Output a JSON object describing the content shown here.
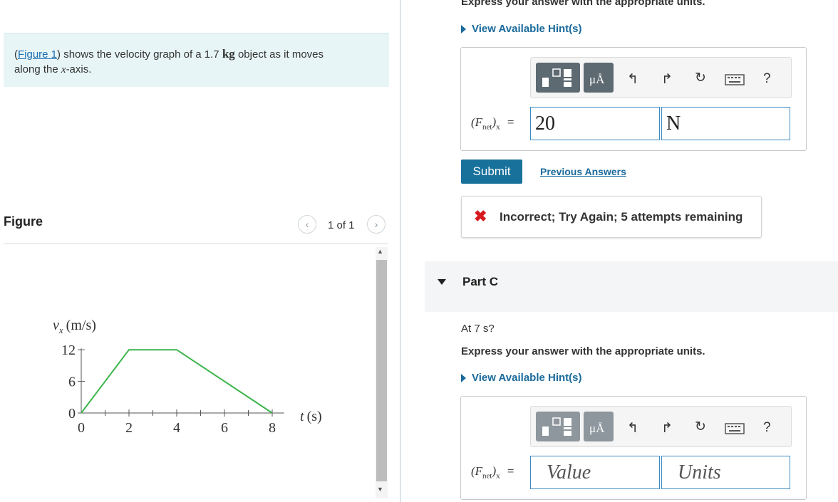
{
  "problem": {
    "figure_link": "Figure 1",
    "text_before_link": "(",
    "text_after_link": ") shows the velocity graph of a 1.7 ",
    "unit_kg": "kg",
    "text_after_unit": " object as it moves",
    "line2_before": "along the ",
    "axis_var": "x",
    "line2_after": "-axis."
  },
  "figure_panel": {
    "label": "Figure",
    "page_counter": "1 of 1",
    "prev_icon": "chevron-left-icon",
    "next_icon": "chevron-right-icon"
  },
  "graph": {
    "y_label": "v",
    "y_label_sub": "x",
    "y_label_unit": "(m/s)",
    "x_label": "t",
    "x_label_unit": "(s)",
    "line_color": "#3cb44b",
    "chart_data": {
      "type": "line",
      "x": [
        0,
        2,
        4,
        8
      ],
      "y": [
        0,
        12,
        12,
        0
      ],
      "xlabel": "t (s)",
      "ylabel": "vx (m/s)",
      "xlim": [
        0,
        8.5
      ],
      "ylim": [
        0,
        12
      ],
      "x_ticks": [
        "0",
        "2",
        "4",
        "6",
        "8"
      ],
      "y_ticks": [
        "0",
        "6",
        "12"
      ],
      "grid": false
    }
  },
  "part_b": {
    "top_instruction": "Express your answer with the appropriate units.",
    "hint_label": "View Available Hint(s)",
    "toolbar": {
      "template_icon": "template-icon",
      "units_label": "μÅ",
      "undo_icon": "undo-icon",
      "redo_icon": "redo-icon",
      "reset_icon": "reset-icon",
      "keyboard_icon": "keyboard-icon",
      "help_label": "?"
    },
    "equation_label": "(F",
    "equation_sub": "net",
    "equation_tail": ")",
    "equation_sub2": "x",
    "equals": "=",
    "value": "20",
    "units": "N",
    "submit_label": "Submit",
    "previous_answers_label": "Previous Answers",
    "feedback": "Incorrect; Try Again; 5 attempts remaining",
    "feedback_color": "#d6191f"
  },
  "part_c": {
    "title": "Part C",
    "question": "At 7 s?",
    "instruction": "Express your answer with the appropriate units.",
    "hint_label": "View Available Hint(s)",
    "toolbar": {
      "units_label": "μÅ",
      "help_label": "?"
    },
    "equation_label": "(F",
    "equation_sub": "net",
    "equation_tail": ")",
    "equation_sub2": "x",
    "equals": "=",
    "value_placeholder": "Value",
    "units_placeholder": "Units"
  }
}
